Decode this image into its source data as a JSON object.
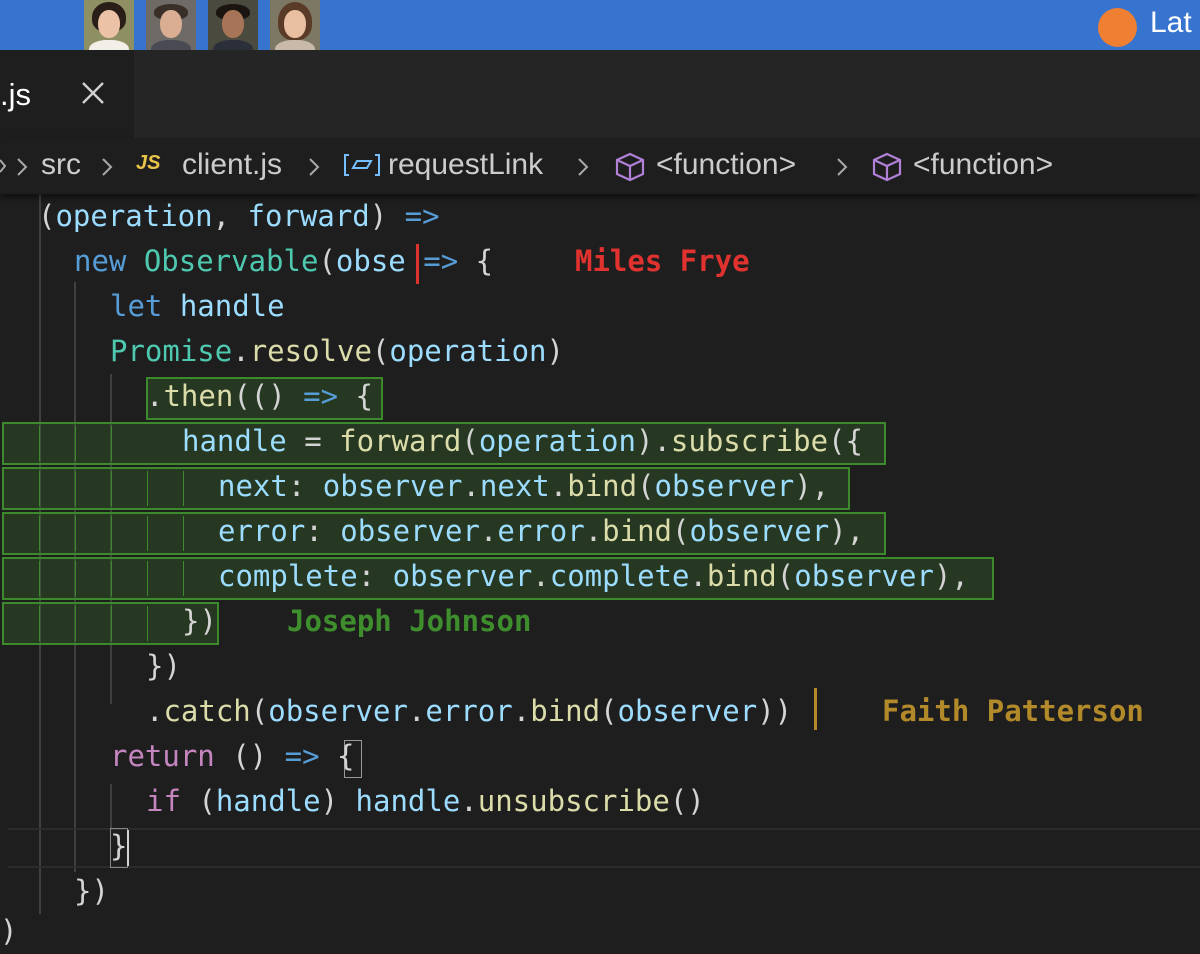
{
  "topbar": {
    "bg_color": "#3774cf",
    "avatars": [
      "avatar-1",
      "avatar-2",
      "avatar-3",
      "avatar-4"
    ],
    "live_label": "Lat",
    "live_color": "#ee7f33"
  },
  "tab": {
    "label": ".js",
    "close_icon": "close-icon"
  },
  "breadcrumb": {
    "items": [
      {
        "label": "src"
      },
      {
        "label": "client.js",
        "icon": "js-file-icon",
        "icon_text": "JS"
      },
      {
        "label": "requestLink",
        "icon": "variable-icon"
      },
      {
        "label": "<function>",
        "icon": "cube-icon"
      },
      {
        "label": "<function>",
        "icon": "cube-icon"
      }
    ]
  },
  "code": {
    "lines": [
      [
        [
          "pl",
          "("
        ],
        [
          "var",
          "operation"
        ],
        [
          "pl",
          ", "
        ],
        [
          "var",
          "forward"
        ],
        [
          "pl",
          ") "
        ],
        [
          "kw",
          "=>"
        ]
      ],
      [
        [
          "kw",
          "new "
        ],
        [
          "cls",
          "Observable"
        ],
        [
          "pl",
          "("
        ],
        [
          "var",
          "obse"
        ],
        [
          "pl",
          " "
        ],
        [
          "kw",
          "=>"
        ],
        [
          "pl",
          " {"
        ]
      ],
      [
        [
          "kw",
          "let "
        ],
        [
          "var",
          "handle"
        ]
      ],
      [
        [
          "cls",
          "Promise"
        ],
        [
          "pl",
          "."
        ],
        [
          "fn",
          "resolve"
        ],
        [
          "pl",
          "("
        ],
        [
          "var",
          "operation"
        ],
        [
          "pl",
          ")"
        ]
      ],
      [
        [
          "pl",
          "."
        ],
        [
          "fn",
          "then"
        ],
        [
          "pl",
          "(() "
        ],
        [
          "kw",
          "=>"
        ],
        [
          "pl",
          " {"
        ]
      ],
      [
        [
          "var",
          "handle"
        ],
        [
          "pl",
          " = "
        ],
        [
          "fn",
          "forward"
        ],
        [
          "pl",
          "("
        ],
        [
          "var",
          "operation"
        ],
        [
          "pl",
          ")."
        ],
        [
          "fn",
          "subscribe"
        ],
        [
          "pl",
          "({"
        ]
      ],
      [
        [
          "var",
          "next"
        ],
        [
          "pl",
          ": "
        ],
        [
          "var",
          "observer"
        ],
        [
          "pl",
          "."
        ],
        [
          "var",
          "next"
        ],
        [
          "pl",
          "."
        ],
        [
          "fn",
          "bind"
        ],
        [
          "pl",
          "("
        ],
        [
          "var",
          "observer"
        ],
        [
          "pl",
          "),"
        ]
      ],
      [
        [
          "var",
          "error"
        ],
        [
          "pl",
          ": "
        ],
        [
          "var",
          "observer"
        ],
        [
          "pl",
          "."
        ],
        [
          "var",
          "error"
        ],
        [
          "pl",
          "."
        ],
        [
          "fn",
          "bind"
        ],
        [
          "pl",
          "("
        ],
        [
          "var",
          "observer"
        ],
        [
          "pl",
          "),"
        ]
      ],
      [
        [
          "var",
          "complete"
        ],
        [
          "pl",
          ": "
        ],
        [
          "var",
          "observer"
        ],
        [
          "pl",
          "."
        ],
        [
          "var",
          "complete"
        ],
        [
          "pl",
          "."
        ],
        [
          "fn",
          "bind"
        ],
        [
          "pl",
          "("
        ],
        [
          "var",
          "observer"
        ],
        [
          "pl",
          "),"
        ]
      ],
      [
        [
          "pl",
          "})"
        ]
      ],
      [
        [
          "pl",
          "})"
        ]
      ],
      [
        [
          "pl",
          "."
        ],
        [
          "fn",
          "catch"
        ],
        [
          "pl",
          "("
        ],
        [
          "var",
          "observer"
        ],
        [
          "pl",
          "."
        ],
        [
          "var",
          "error"
        ],
        [
          "pl",
          "."
        ],
        [
          "fn",
          "bind"
        ],
        [
          "pl",
          "("
        ],
        [
          "var",
          "observer"
        ],
        [
          "pl",
          "))"
        ]
      ],
      [
        [
          "kw2",
          "return"
        ],
        [
          "pl",
          " () "
        ],
        [
          "kw",
          "=>"
        ],
        [
          "pl",
          " {"
        ]
      ],
      [
        [
          "kw2",
          "if"
        ],
        [
          "pl",
          " ("
        ],
        [
          "var",
          "handle"
        ],
        [
          "pl",
          ") "
        ],
        [
          "var",
          "handle"
        ],
        [
          "pl",
          "."
        ],
        [
          "fn",
          "unsubscribe"
        ],
        [
          "pl",
          "()"
        ]
      ],
      [
        [
          "pl",
          "}"
        ]
      ],
      [
        [
          "pl",
          "})"
        ]
      ]
    ]
  },
  "collaborators": [
    {
      "name": "Miles Frye",
      "color": "#e0322f"
    },
    {
      "name": "Joseph Johnson",
      "color": "#3f8e2e"
    },
    {
      "name": "Faith Patterson",
      "color": "#b38a2a"
    }
  ]
}
